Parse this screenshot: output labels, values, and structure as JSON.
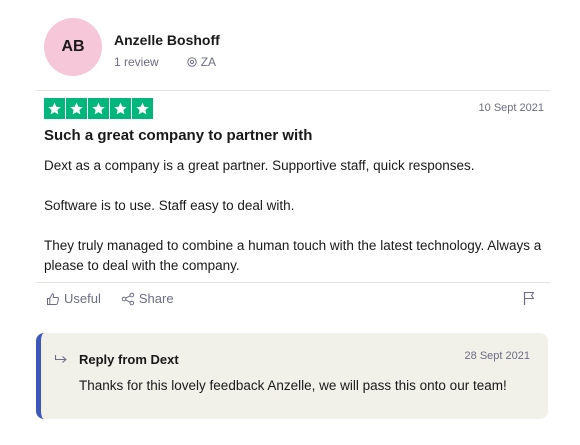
{
  "reviewer": {
    "initials": "AB",
    "name": "Anzelle Boshoff",
    "review_count": "1 review",
    "country": "ZA",
    "avatar_color": "#f6c7d8"
  },
  "review": {
    "rating": 5,
    "rating_max": 5,
    "star_color": "#00b67a",
    "date": "10 Sept 2021",
    "title": "Such a great company to partner with",
    "paragraphs": [
      "Dext as a company is a great partner. Supportive staff, quick responses.",
      "Software is to use. Staff easy to deal with.",
      "They truly managed to combine a human touch with the latest technology. Always a please to deal with the company."
    ]
  },
  "actions": {
    "useful_label": "Useful",
    "share_label": "Share"
  },
  "reply": {
    "title": "Reply from Dext",
    "date": "28 Sept 2021",
    "text": "Thanks for this lovely feedback Anzelle, we will pass this onto our team!",
    "accent_color": "#3c57bc"
  }
}
